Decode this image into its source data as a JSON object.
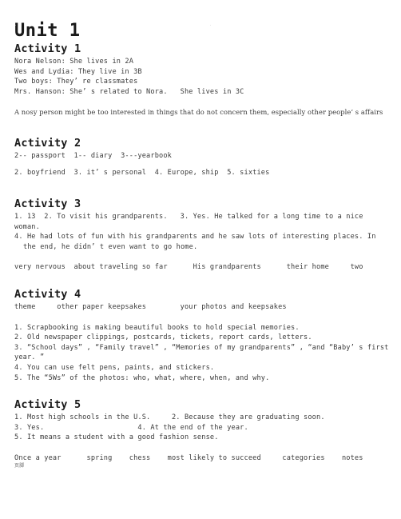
{
  "document": {
    "unit_title": "Unit 1",
    "header_marks": {
      "left": ".",
      "right": "."
    },
    "footer_note": "页脚"
  },
  "activities": [
    {
      "title": "Activity 1",
      "lines": [
        "Nora Nelson: She lives in 2A",
        "Wes and Lydia: They live in 3B",
        "Two boys: They’ re classmates",
        "Mrs. Hanson: She’ s related to Nora.   She lives in 3C"
      ],
      "paragraph": "A nosy person might be too interested in things that do not concern them, especially other people’ s affairs"
    },
    {
      "title": "Activity 2",
      "lines": [
        "2-- passport  1-- diary  3---yearbook"
      ],
      "lines_second": [
        "2. boyfriend  3. it’ s personal  4. Europe, ship  5. sixties"
      ]
    },
    {
      "title": "Activity 3",
      "lines": [
        "1. 13  2. To visit his grandparents.   3. Yes. He talked for a long time to a nice woman.",
        "4. He had lots of fun with his grandparents and he saw lots of interesting places. In the end, he didn’ t even want to go home."
      ],
      "keywords": "very nervous  about traveling so far      His grandparents      their home     two"
    },
    {
      "title": "Activity 4",
      "keywords": "theme     other paper keepsakes        your photos and keepsakes",
      "lines": [
        "1. Scrapbooking is making beautiful books to hold special memories.",
        "2. Old newspaper clippings, postcards, tickets, report cards, letters.",
        "3. “School days” , “Family travel” , “Memories of my grandparents” , “and “Baby’ s first year. ”",
        "4. You can use felt pens, paints, and stickers.",
        "5. The “5Ws” of the photos: who, what, where, when, and why."
      ]
    },
    {
      "title": "Activity 5",
      "lines": [
        "1. Most high schools in the U.S.     2. Because they are graduating soon.",
        "3. Yes.                      4. At the end of the year.",
        "5. It means a student with a good fashion sense."
      ],
      "keywords": "Once a year      spring    chess    most likely to succeed     categories    notes"
    }
  ]
}
